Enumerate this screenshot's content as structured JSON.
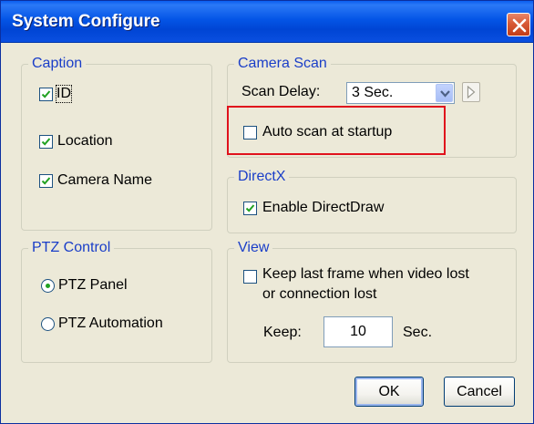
{
  "window": {
    "title": "System Configure"
  },
  "caption": {
    "legend": "Caption",
    "items": [
      {
        "label": "ID",
        "checked": true
      },
      {
        "label": "Location",
        "checked": true
      },
      {
        "label": "Camera Name",
        "checked": true
      }
    ]
  },
  "ptz": {
    "legend": "PTZ Control",
    "options": [
      {
        "label": "PTZ Panel",
        "selected": true
      },
      {
        "label": "PTZ Automation",
        "selected": false
      }
    ]
  },
  "camera_scan": {
    "legend": "Camera Scan",
    "delay_label": "Scan Delay:",
    "delay_value": "3 Sec.",
    "auto_scan_label": "Auto scan at startup",
    "auto_scan_checked": false,
    "highlight_color": "#e0121c"
  },
  "directx": {
    "legend": "DirectX",
    "enable_label": "Enable DirectDraw",
    "enable_checked": true
  },
  "view": {
    "legend": "View",
    "keep_last_line1": "Keep last frame when video lost",
    "keep_last_line2": "or connection lost",
    "keep_last_checked": false,
    "keep_label": "Keep:",
    "keep_value": "10",
    "unit": "Sec."
  },
  "buttons": {
    "ok": "OK",
    "cancel": "Cancel"
  },
  "colors": {
    "titlebar": "#0455e6",
    "legend_text": "#1a3ec8",
    "check_mark": "#21a121",
    "dialog_bg": "#ece9d8"
  }
}
